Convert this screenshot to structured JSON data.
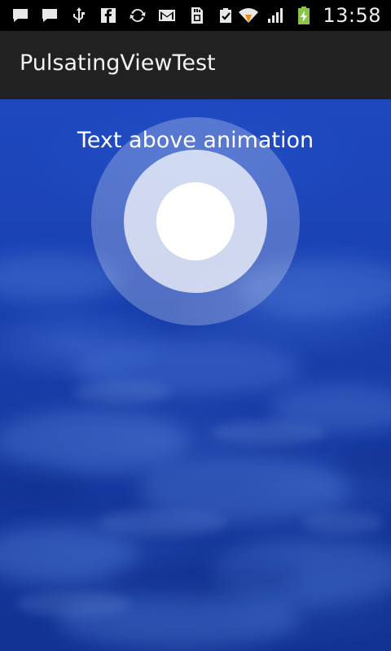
{
  "status_bar": {
    "time": "13:58",
    "icons_left": [
      "message-icon",
      "message-icon",
      "usb-icon",
      "facebook-icon",
      "sync-icon",
      "gmail-icon",
      "sd-card-icon",
      "clipboard-check-icon"
    ],
    "icons_right": [
      "wifi-icon",
      "signal-icon",
      "battery-charging-icon"
    ]
  },
  "action_bar": {
    "title": "PulsatingViewTest"
  },
  "content": {
    "label": "Text above animation"
  },
  "colors": {
    "status_bar_bg": "#000000",
    "action_bar_bg": "#212121",
    "sky_blue": "#1a42b3",
    "battery_green": "#8bc34a"
  }
}
